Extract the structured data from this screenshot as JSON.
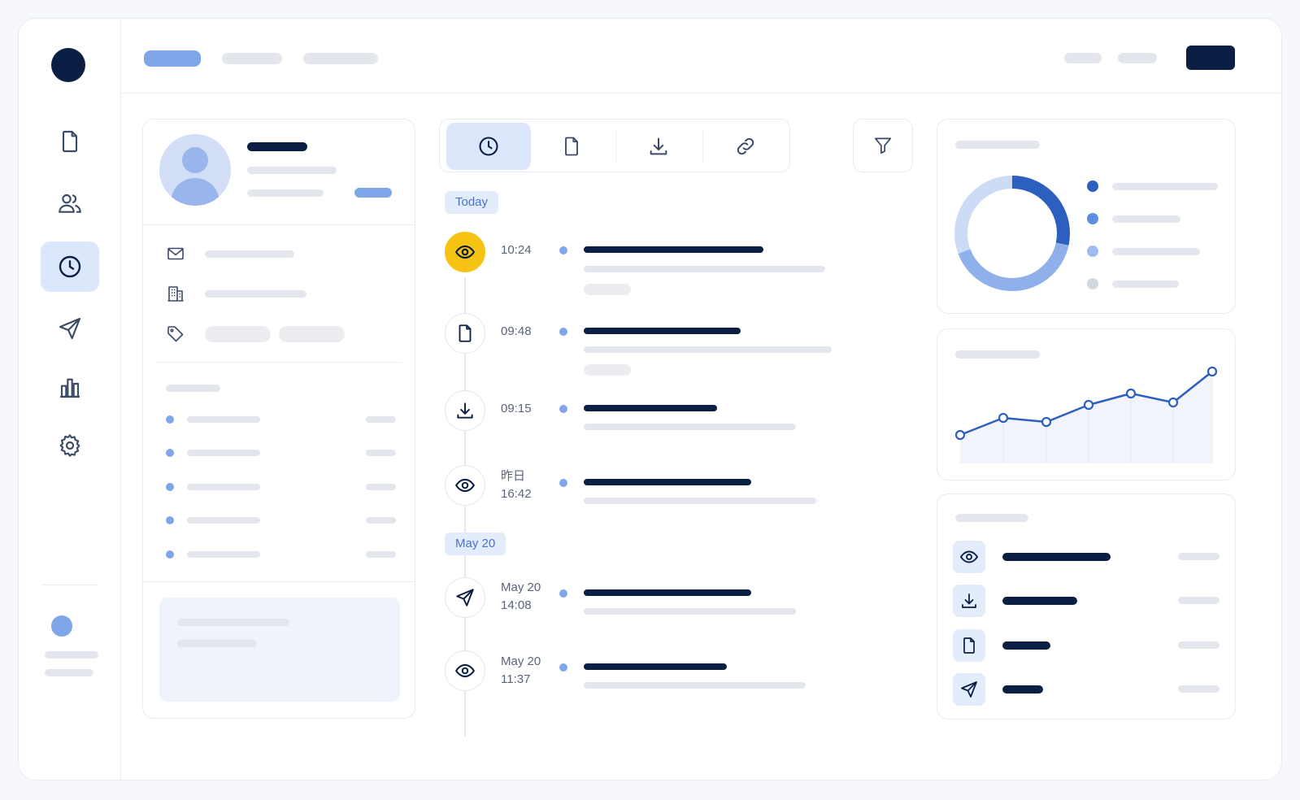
{
  "timeline": {
    "groups": {
      "today": "Today",
      "may20": "May 20"
    },
    "events": [
      {
        "time": "10:24",
        "icon": "eye-icon",
        "highlighted": true
      },
      {
        "time": "09:48",
        "icon": "file-icon"
      },
      {
        "time": "09:15",
        "icon": "download-icon"
      },
      {
        "date": "昨日",
        "time": "16:42",
        "icon": "eye-icon"
      },
      {
        "date": "May 20",
        "time": "14:08",
        "icon": "send-icon"
      },
      {
        "date": "May 20",
        "time": "11:37",
        "icon": "eye-icon"
      }
    ]
  },
  "sidebar": {
    "icons": [
      "file-icon",
      "users-icon",
      "clock-icon",
      "send-icon",
      "chart-icon",
      "gear-icon"
    ],
    "active": "clock-icon"
  },
  "tabs": {
    "icons": [
      "clock-icon",
      "file-icon",
      "download-icon",
      "link-icon"
    ],
    "active": "clock-icon"
  },
  "colors": {
    "accent": "#7ea6e8",
    "dark": "#0b1f44",
    "highlight": "#f7c312",
    "donut_primary": "#2d5fbf",
    "donut_secondary": "#8fb0ea",
    "donut_light": "#cddcf6"
  }
}
